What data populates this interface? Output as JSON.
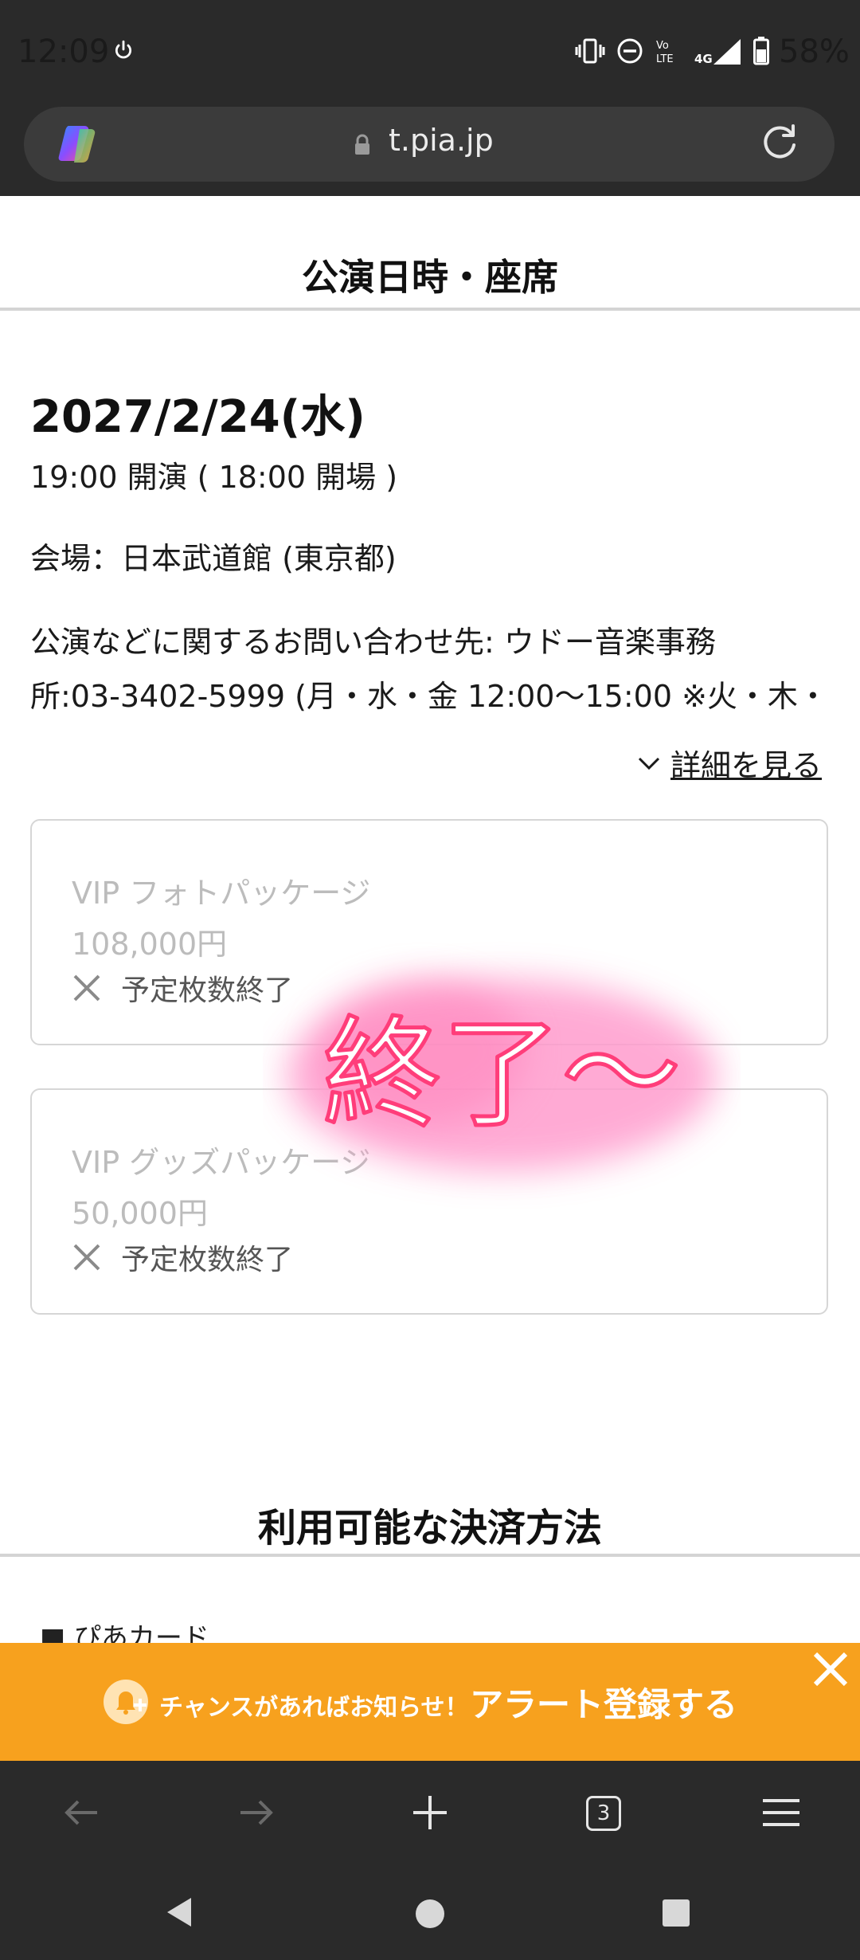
{
  "status_bar": {
    "time": "12:09",
    "battery": "58%",
    "icons": [
      "power-icon",
      "vibrate-icon",
      "do-not-disturb-icon",
      "volte-icon",
      "4g-signal-icon",
      "battery-icon"
    ]
  },
  "url_bar": {
    "url": "t.pia.jp"
  },
  "page": {
    "heading": "公演日時・座席",
    "date": "2027/2/24(水)",
    "time": "19:00 開演 ( 18:00 開場 )",
    "venue": "会場：日本武道館 (東京都)",
    "contact_line1": "公演などに関するお問い合わせ先: ウドー音楽事務",
    "contact_line2": "所:03-3402-5999 (月・水・金 12:00～15:00 ※火・木・",
    "details_link": "詳細を見る",
    "tickets": [
      {
        "name": "VIP フォトパッケージ",
        "price": "108,000円",
        "status": "予定枚数終了"
      },
      {
        "name": "VIP グッズパッケージ",
        "price": "50,000円",
        "status": "予定枚数終了"
      }
    ],
    "overlay_text": "終了〜",
    "payment_heading": "利用可能な決済方法",
    "payment_first_item": "ぴあカード"
  },
  "alert_banner": {
    "small_text": "チャンスがあればお知らせ！",
    "big_text": "アラート登録する"
  },
  "bottom_bar": {
    "tab_count": "3"
  },
  "colors": {
    "alert_orange": "#f7a11e",
    "overlay_pink": "#ff3d7a",
    "overlay_glow": "#ff9ccd"
  }
}
